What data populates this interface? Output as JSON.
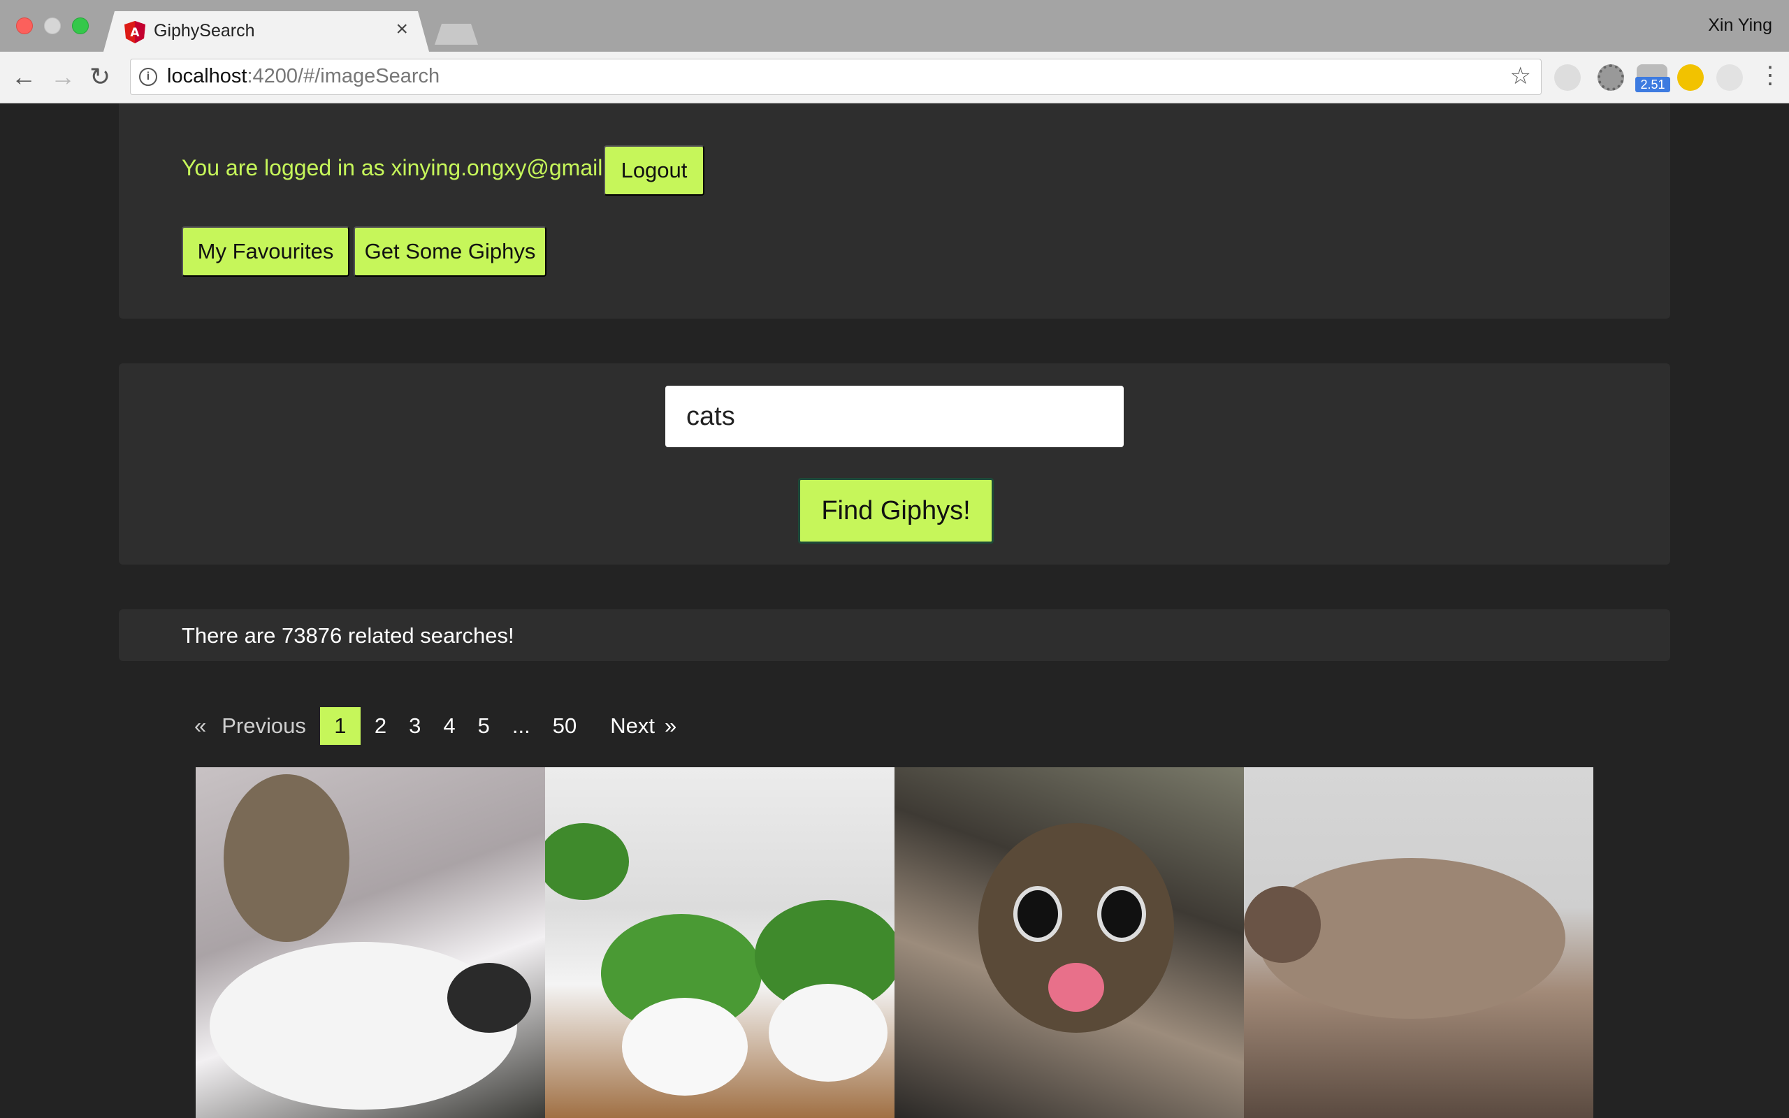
{
  "browser": {
    "tab_title": "GiphySearch",
    "tab_close": "×",
    "profile_name": "Xin Ying",
    "url_host": "localhost",
    "url_rest": ":4200/#/imageSearch",
    "extension_badge": "2.51",
    "icons": [
      "back-arrow-icon",
      "forward-arrow-icon",
      "reload-icon",
      "info-icon",
      "star-icon",
      "menu-dots-icon"
    ]
  },
  "header": {
    "logged_in_text": "You are logged in as xinying.ongxy@gmail.com",
    "logout_label": "Logout",
    "favourites_label": "My Favourites",
    "get_giphys_label": "Get Some Giphys"
  },
  "search": {
    "query": "cats",
    "button_label": "Find Giphys!"
  },
  "results": {
    "count_text": "There are 73876 related searches!"
  },
  "pagination": {
    "prev_symbol": "«",
    "prev_label": "Previous",
    "pages": [
      "1",
      "2",
      "3",
      "4",
      "5",
      "...",
      "50"
    ],
    "active_page": "1",
    "next_label": "Next",
    "next_symbol": "»"
  },
  "colors": {
    "accent": "#c6f65a",
    "background": "#232323",
    "panel": "#2e2e2e"
  }
}
